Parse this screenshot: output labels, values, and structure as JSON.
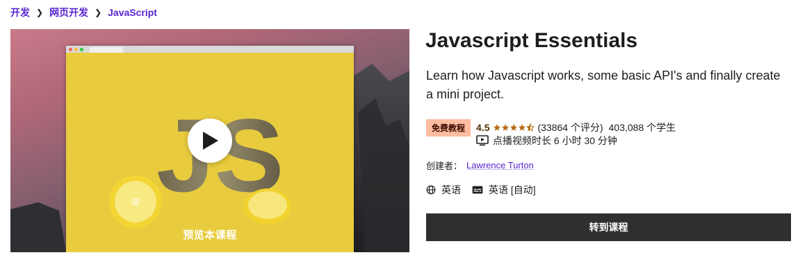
{
  "breadcrumb": {
    "items": [
      "开发",
      "网页开发",
      "JavaScript"
    ]
  },
  "preview": {
    "label": "预览本课程",
    "logo_text": "JS"
  },
  "course": {
    "title": "Javascript Essentials",
    "subtitle": "Learn how Javascript works, some basic API's and finally create a mini project.",
    "badge": "免费教程",
    "rating": "4.5",
    "rating_count": "(33864 个评分)",
    "students": "403,088 个学生",
    "duration": "点播视频时长 6 小时 30 分钟",
    "creator_label": "创建者：",
    "creator_name": "Lawrence Turton",
    "language": "英语",
    "captions": "英语 [自动]"
  },
  "cta": {
    "label": "转到课程"
  },
  "icons": {
    "play": "play-icon",
    "video": "video-icon",
    "globe": "globe-icon",
    "captions": "captions-icon",
    "star": "star-icon",
    "chevron": "chevron-right-icon"
  },
  "colors": {
    "link": "#5624d0",
    "badge_bg": "#fcbca0",
    "star": "#b4690e",
    "button_bg": "#2d2f31",
    "js_yellow": "#e9cc3d"
  }
}
